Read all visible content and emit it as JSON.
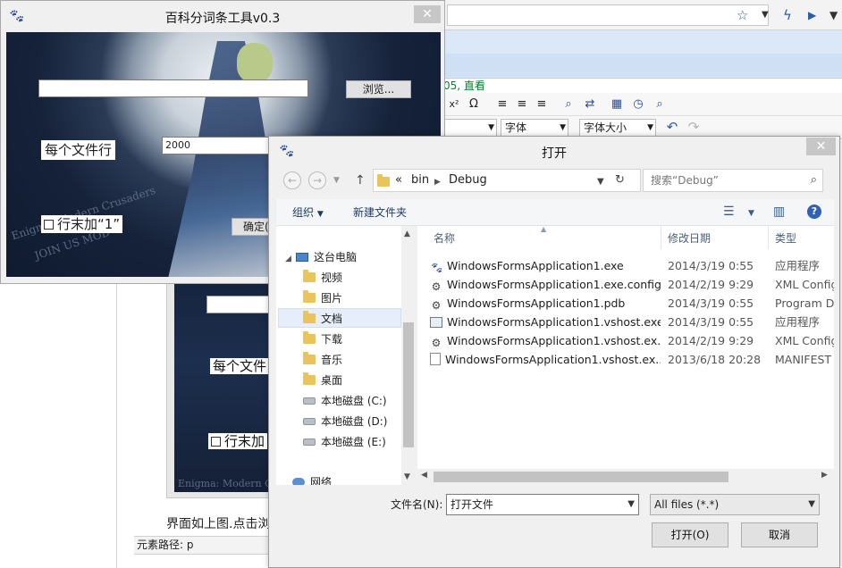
{
  "editor": {
    "link_text": "05, 直看",
    "font_family_value": "字体",
    "font_size_value": "字体大小",
    "preview_lines_label": "每个文件",
    "preview_suffix_label": "行末加",
    "preview_art_text": "Enigma: Modern Crusaders",
    "page_text": "界面如上图.点击浏",
    "status_path": "元素路径: p"
  },
  "app": {
    "title": "百科分词条工具v0.3",
    "close_glyph": "✕",
    "path_value": "",
    "browse_label": "浏览...",
    "lines_label": "每个文件行",
    "lines_value": "2000",
    "suffix_label": "行末加“1”",
    "ok_label": "确定(",
    "art_text": "Enigma: Modern Crusaders",
    "art_text2": "JOIN US MOD"
  },
  "dialog": {
    "title": "打开",
    "close_glyph": "✕",
    "address": {
      "prefix": "«",
      "segments": [
        "bin",
        "Debug"
      ]
    },
    "search_placeholder": "搜索“Debug”",
    "organize_label": "组织",
    "new_folder_label": "新建文件夹",
    "nav_items": [
      {
        "label": "这台电脑",
        "kind": "pc"
      },
      {
        "label": "视频",
        "kind": "folder"
      },
      {
        "label": "图片",
        "kind": "folder"
      },
      {
        "label": "文档",
        "kind": "folder"
      },
      {
        "label": "下载",
        "kind": "folder"
      },
      {
        "label": "音乐",
        "kind": "folder"
      },
      {
        "label": "桌面",
        "kind": "folder"
      },
      {
        "label": "本地磁盘 (C:)",
        "kind": "drive"
      },
      {
        "label": "本地磁盘 (D:)",
        "kind": "drive"
      },
      {
        "label": "本地磁盘 (E:)",
        "kind": "drive"
      },
      {
        "label": "网络",
        "kind": "network"
      }
    ],
    "columns": {
      "name": "名称",
      "date": "修改日期",
      "type": "类型"
    },
    "files": [
      {
        "name": "WindowsFormsApplication1.exe",
        "date": "2014/3/19 0:55",
        "type": "应用程序",
        "icon": "exe"
      },
      {
        "name": "WindowsFormsApplication1.exe.config",
        "date": "2014/2/19 9:29",
        "type": "XML Config",
        "icon": "cfg"
      },
      {
        "name": "WindowsFormsApplication1.pdb",
        "date": "2014/3/19 0:55",
        "type": "Program De",
        "icon": "cfg"
      },
      {
        "name": "WindowsFormsApplication1.vshost.exe",
        "date": "2014/3/19 0:55",
        "type": "应用程序",
        "icon": "win"
      },
      {
        "name": "WindowsFormsApplication1.vshost.ex...",
        "date": "2014/2/19 9:29",
        "type": "XML Config",
        "icon": "cfg"
      },
      {
        "name": "WindowsFormsApplication1.vshost.ex...",
        "date": "2013/6/18 20:28",
        "type": "MANIFEST 文",
        "icon": "doc"
      }
    ],
    "filename_label": "文件名(N):",
    "filename_value": "打开文件",
    "filter_value": "All files (*.*)",
    "open_label": "打开(O)",
    "cancel_label": "取消"
  }
}
